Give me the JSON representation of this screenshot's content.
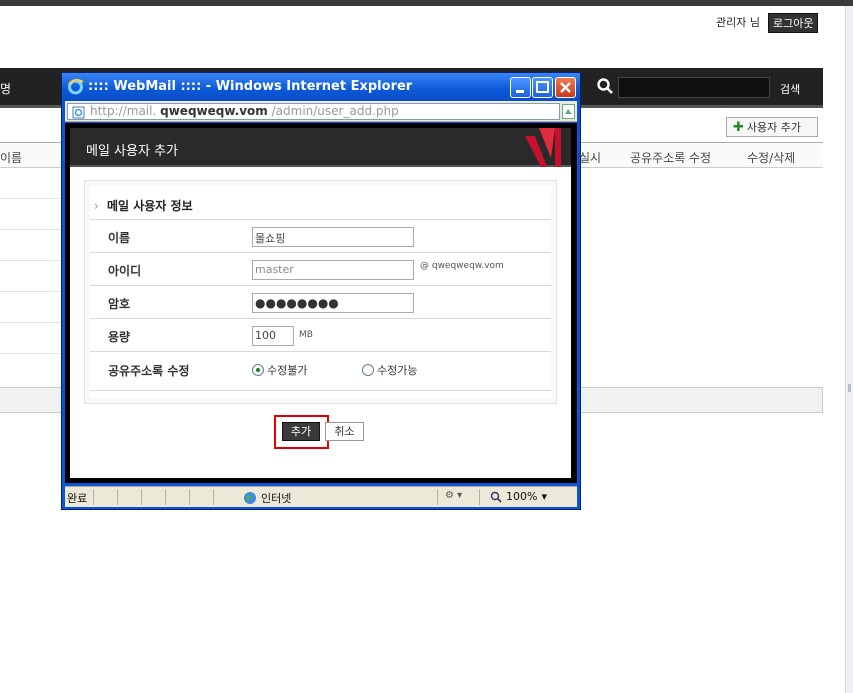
{
  "header": {
    "admin_label": "관리자 님",
    "logout_label": "로그아웃"
  },
  "nav": {
    "left_label": "명",
    "search_placeholder": "",
    "search_button": "검색"
  },
  "toolbar": {
    "add_user_label": "사용자 추가"
  },
  "table": {
    "col_name": "이름",
    "col_partial": "실시",
    "col_address_book": "공유주소록 수정",
    "col_edit_delete": "수정/삭제"
  },
  "popup": {
    "window_title": ":::: WebMail :::: - Windows Internet Explorer",
    "address_prefix": "http://mail.",
    "address_domain": "qweqweqw.vom",
    "address_path": "/admin/user_add.php",
    "dialog_title": "메일 사용자 추가",
    "section_title": "메일 사용자 정보",
    "fields": {
      "name_label": "이름",
      "name_value": "몰쇼핑",
      "id_label": "아이디",
      "id_value": "master",
      "id_domain": "@ qweqweqw.vom",
      "password_label": "암호",
      "password_value": "●●●●●●●●",
      "quota_label": "용량",
      "quota_value": "100",
      "quota_unit": "MB",
      "share_label": "공유주소록 수정",
      "share_option_1": "수정불가",
      "share_option_2": "수정가능",
      "share_selected": "수정불가"
    },
    "add_button": "추가",
    "cancel_button": "취소",
    "status": {
      "done": "완료",
      "zone": "인터넷",
      "zoom": "100%"
    }
  },
  "colors": {
    "navbar": "#222222",
    "ie_blue": "#0b54d6",
    "highlight": "#e00000",
    "accent_red": "#c8102e"
  }
}
